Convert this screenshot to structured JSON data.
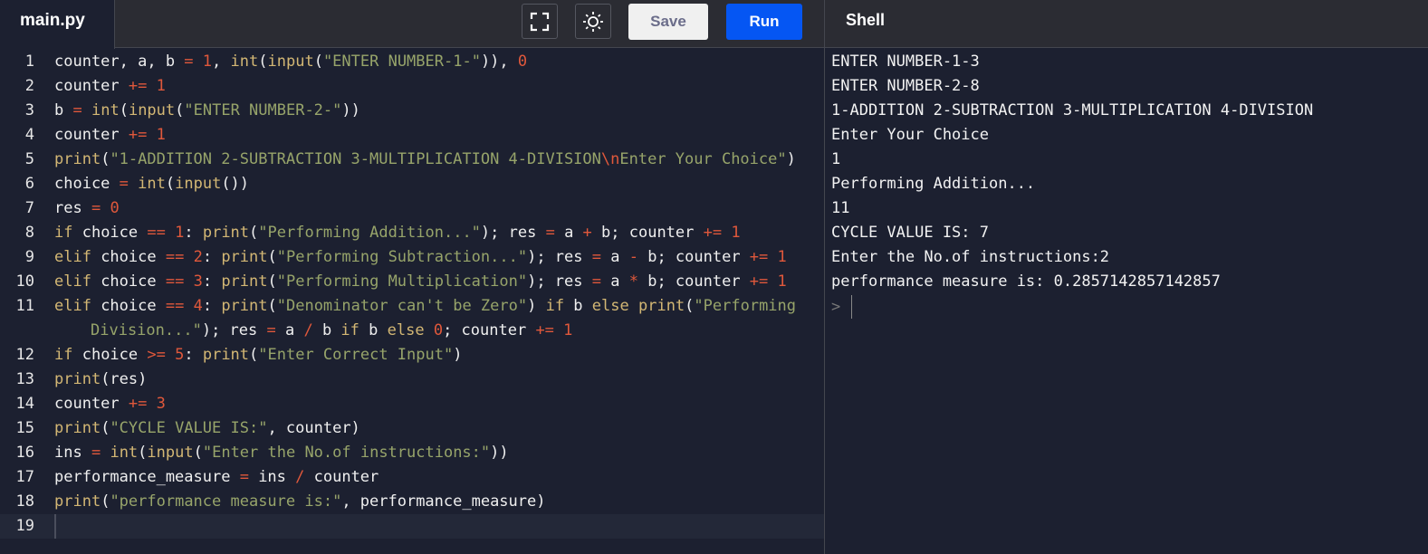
{
  "editor": {
    "tab_label": "main.py",
    "lines": [
      [
        [
          "p",
          "counter, a, b "
        ],
        [
          "o",
          "="
        ],
        [
          "p",
          " "
        ],
        [
          "n",
          "1"
        ],
        [
          "p",
          ", "
        ],
        [
          "k",
          "int"
        ],
        [
          "p",
          "("
        ],
        [
          "k",
          "input"
        ],
        [
          "p",
          "("
        ],
        [
          "s",
          "\"ENTER NUMBER-1-\""
        ],
        [
          "p",
          "))"
        ],
        [
          "p",
          ", "
        ],
        [
          "n",
          "0"
        ]
      ],
      [
        [
          "p",
          "counter "
        ],
        [
          "o",
          "+="
        ],
        [
          "p",
          " "
        ],
        [
          "n",
          "1"
        ]
      ],
      [
        [
          "p",
          "b "
        ],
        [
          "o",
          "="
        ],
        [
          "p",
          " "
        ],
        [
          "k",
          "int"
        ],
        [
          "p",
          "("
        ],
        [
          "k",
          "input"
        ],
        [
          "p",
          "("
        ],
        [
          "s",
          "\"ENTER NUMBER-2-\""
        ],
        [
          "p",
          "))"
        ]
      ],
      [
        [
          "p",
          "counter "
        ],
        [
          "o",
          "+="
        ],
        [
          "p",
          " "
        ],
        [
          "n",
          "1"
        ]
      ],
      [
        [
          "k",
          "print"
        ],
        [
          "p",
          "("
        ],
        [
          "s",
          "\"1-ADDITION 2-SUBTRACTION 3-MULTIPLICATION 4-DIVISION"
        ],
        [
          "o",
          "\\n"
        ],
        [
          "s",
          "Enter Your Choice\""
        ],
        [
          "p",
          ")"
        ]
      ],
      [
        [
          "p",
          "choice "
        ],
        [
          "o",
          "="
        ],
        [
          "p",
          " "
        ],
        [
          "k",
          "int"
        ],
        [
          "p",
          "("
        ],
        [
          "k",
          "input"
        ],
        [
          "p",
          "())"
        ]
      ],
      [
        [
          "p",
          "res "
        ],
        [
          "o",
          "="
        ],
        [
          "p",
          " "
        ],
        [
          "n",
          "0"
        ]
      ],
      [
        [
          "k",
          "if"
        ],
        [
          "p",
          " choice "
        ],
        [
          "o",
          "=="
        ],
        [
          "p",
          " "
        ],
        [
          "n",
          "1"
        ],
        [
          "p",
          ": "
        ],
        [
          "k",
          "print"
        ],
        [
          "p",
          "("
        ],
        [
          "s",
          "\"Performing Addition...\""
        ],
        [
          "p",
          "); res "
        ],
        [
          "o",
          "="
        ],
        [
          "p",
          " a "
        ],
        [
          "o",
          "+"
        ],
        [
          "p",
          " b; counter "
        ],
        [
          "o",
          "+="
        ],
        [
          "p",
          " "
        ],
        [
          "n",
          "1"
        ]
      ],
      [
        [
          "k",
          "elif"
        ],
        [
          "p",
          " choice "
        ],
        [
          "o",
          "=="
        ],
        [
          "p",
          " "
        ],
        [
          "n",
          "2"
        ],
        [
          "p",
          ": "
        ],
        [
          "k",
          "print"
        ],
        [
          "p",
          "("
        ],
        [
          "s",
          "\"Performing Subtraction...\""
        ],
        [
          "p",
          "); res "
        ],
        [
          "o",
          "="
        ],
        [
          "p",
          " a "
        ],
        [
          "o",
          "-"
        ],
        [
          "p",
          " b; counter "
        ],
        [
          "o",
          "+="
        ],
        [
          "p",
          " "
        ],
        [
          "n",
          "1"
        ]
      ],
      [
        [
          "k",
          "elif"
        ],
        [
          "p",
          " choice "
        ],
        [
          "o",
          "=="
        ],
        [
          "p",
          " "
        ],
        [
          "n",
          "3"
        ],
        [
          "p",
          ": "
        ],
        [
          "k",
          "print"
        ],
        [
          "p",
          "("
        ],
        [
          "s",
          "\"Performing Multiplication\""
        ],
        [
          "p",
          "); res "
        ],
        [
          "o",
          "="
        ],
        [
          "p",
          " a "
        ],
        [
          "o",
          "*"
        ],
        [
          "p",
          " b; counter "
        ],
        [
          "o",
          "+="
        ],
        [
          "p",
          " "
        ],
        [
          "n",
          "1"
        ]
      ],
      [
        [
          "k",
          "elif"
        ],
        [
          "p",
          " choice "
        ],
        [
          "o",
          "=="
        ],
        [
          "p",
          " "
        ],
        [
          "n",
          "4"
        ],
        [
          "p",
          ": "
        ],
        [
          "k",
          "print"
        ],
        [
          "p",
          "("
        ],
        [
          "s",
          "\"Denominator can't be Zero\""
        ],
        [
          "p",
          ") "
        ],
        [
          "k",
          "if"
        ],
        [
          "p",
          " b "
        ],
        [
          "k",
          "else"
        ],
        [
          "p",
          " "
        ],
        [
          "k",
          "print"
        ],
        [
          "p",
          "("
        ],
        [
          "s",
          "\"Performing Division...\""
        ],
        [
          "p",
          "); res "
        ],
        [
          "o",
          "="
        ],
        [
          "p",
          " a "
        ],
        [
          "o",
          "/"
        ],
        [
          "p",
          " b "
        ],
        [
          "k",
          "if"
        ],
        [
          "p",
          " b "
        ],
        [
          "k",
          "else"
        ],
        [
          "p",
          " "
        ],
        [
          "n",
          "0"
        ],
        [
          "p",
          "; counter "
        ],
        [
          "o",
          "+="
        ],
        [
          "p",
          " "
        ],
        [
          "n",
          "1"
        ]
      ],
      [
        [
          "k",
          "if"
        ],
        [
          "p",
          " choice "
        ],
        [
          "o",
          ">="
        ],
        [
          "p",
          " "
        ],
        [
          "n",
          "5"
        ],
        [
          "p",
          ": "
        ],
        [
          "k",
          "print"
        ],
        [
          "p",
          "("
        ],
        [
          "s",
          "\"Enter Correct Input\""
        ],
        [
          "p",
          ")"
        ]
      ],
      [
        [
          "k",
          "print"
        ],
        [
          "p",
          "(res)"
        ]
      ],
      [
        [
          "p",
          "counter "
        ],
        [
          "o",
          "+="
        ],
        [
          "p",
          " "
        ],
        [
          "n",
          "3"
        ]
      ],
      [
        [
          "k",
          "print"
        ],
        [
          "p",
          "("
        ],
        [
          "s",
          "\"CYCLE VALUE IS:\""
        ],
        [
          "p",
          ", counter)"
        ]
      ],
      [
        [
          "p",
          "ins "
        ],
        [
          "o",
          "="
        ],
        [
          "p",
          " "
        ],
        [
          "k",
          "int"
        ],
        [
          "p",
          "("
        ],
        [
          "k",
          "input"
        ],
        [
          "p",
          "("
        ],
        [
          "s",
          "\"Enter the No.of instructions:\""
        ],
        [
          "p",
          "))"
        ]
      ],
      [
        [
          "p",
          "performance_measure "
        ],
        [
          "o",
          "="
        ],
        [
          "p",
          " ins "
        ],
        [
          "o",
          "/"
        ],
        [
          "p",
          " counter"
        ]
      ],
      [
        [
          "k",
          "print"
        ],
        [
          "p",
          "("
        ],
        [
          "s",
          "\"performance measure is:\""
        ],
        [
          "p",
          ", performance_measure)"
        ]
      ],
      []
    ]
  },
  "toolbar": {
    "save_label": "Save",
    "run_label": "Run",
    "fullscreen_icon": "fullscreen-icon",
    "theme_icon": "sun-icon"
  },
  "shell": {
    "title": "Shell",
    "prompt": ">",
    "output": [
      "ENTER NUMBER-1-3",
      "ENTER NUMBER-2-8",
      "1-ADDITION 2-SUBTRACTION 3-MULTIPLICATION 4-DIVISION",
      "Enter Your Choice",
      "1",
      "Performing Addition...",
      "11",
      "CYCLE VALUE IS: 7",
      "Enter the No.of instructions:2",
      "performance measure is: 0.2857142857142857"
    ]
  },
  "colors": {
    "background": "#1c2030",
    "keyword": "#d3b774",
    "string": "#97a46a",
    "number": "#e0583b",
    "run_button": "#0556f3"
  }
}
